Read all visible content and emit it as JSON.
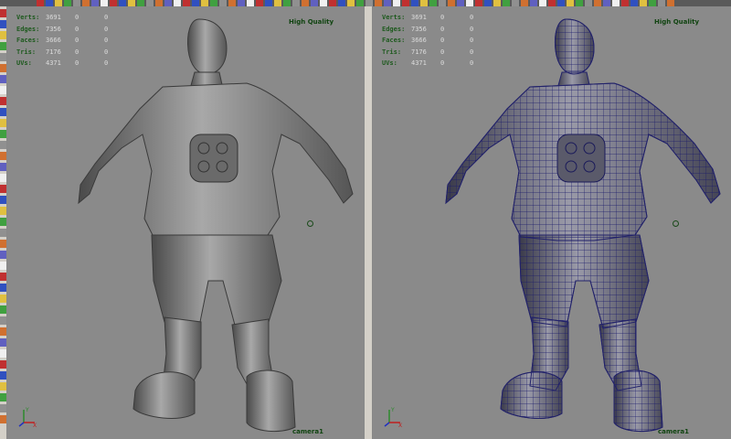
{
  "hud": {
    "rows": [
      {
        "label": "Verts:",
        "value": "3691",
        "c1": "0",
        "c2": "0"
      },
      {
        "label": "Edges:",
        "value": "7356",
        "c1": "0",
        "c2": "0"
      },
      {
        "label": "Faces:",
        "value": "3666",
        "c1": "0",
        "c2": "0"
      },
      {
        "label": "Tris:",
        "value": "7176",
        "c1": "0",
        "c2": "0"
      },
      {
        "label": "UVs:",
        "value": "4371",
        "c1": "0",
        "c2": "0"
      }
    ]
  },
  "left_view": {
    "quality_label": "High Quality",
    "camera_label": "camera1",
    "shading": "smooth-shaded"
  },
  "right_view": {
    "quality_label": "High Quality",
    "camera_label": "camera1",
    "shading": "wireframe-on-shaded"
  },
  "axis": {
    "y": "Y",
    "x": "X",
    "z": "Z"
  },
  "icons": {
    "top_strip": "toolbar-icons",
    "side_tools": "tool-box-icons"
  },
  "colors": {
    "viewport_bg": "#8a8a8a",
    "hud_label": "#1e5a1e",
    "wire": "#2a2a8a"
  }
}
